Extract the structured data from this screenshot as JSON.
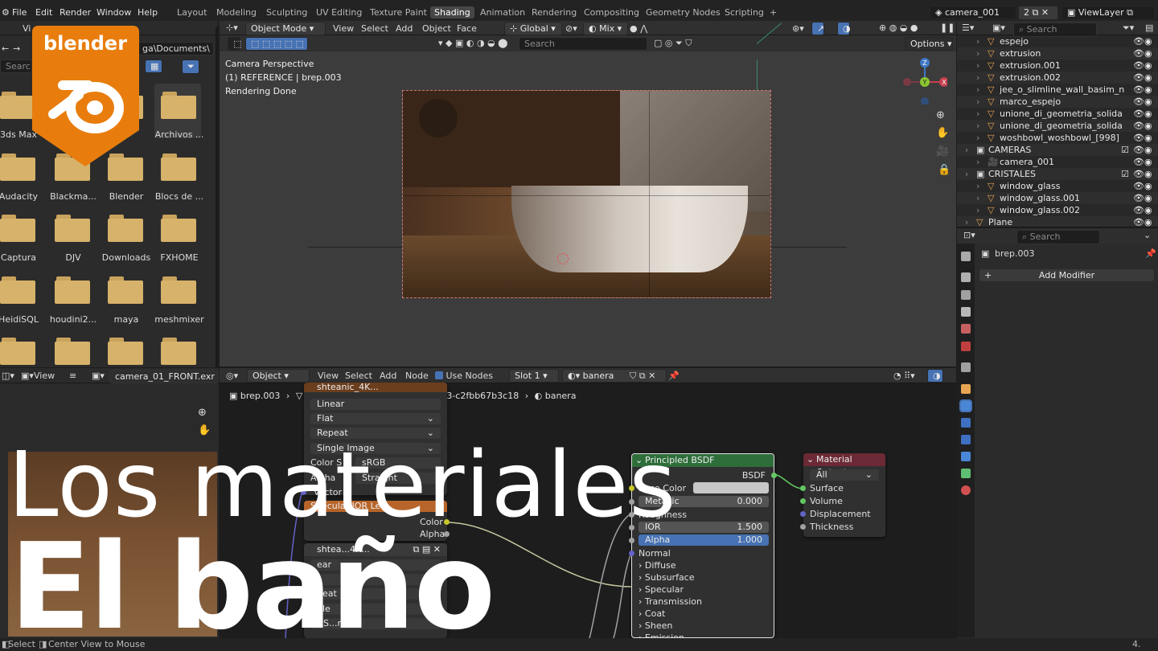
{
  "app": {
    "logo_text": "blender",
    "brand_color": "#e87d0d"
  },
  "topbar": {
    "menus": [
      "File",
      "Edit",
      "Render",
      "Window",
      "Help"
    ],
    "workspaces": [
      "Layout",
      "Modeling",
      "Sculpting",
      "UV Editing",
      "Texture Paint",
      "Shading",
      "Animation",
      "Rendering",
      "Compositing",
      "Geometry Nodes",
      "Scripting"
    ],
    "active_workspace": "Shading",
    "add_tab": "+",
    "scene_name": "camera_001",
    "scene_users": "2",
    "view_layer": "ViewLayer"
  },
  "filebrowser": {
    "header_label": "Vi",
    "path": "ga\\Documents\\",
    "search_placeholder": "Searc",
    "folders": [
      "3ds Max",
      "",
      "",
      "Archivos ...",
      "Audacity",
      "Blackma...",
      "Blender",
      "Blocs de ...",
      "Captura",
      "DJV",
      "Downloads",
      "FXHOME",
      "HeidiSQL",
      "houdini2...",
      "maya",
      "meshmixer",
      "",
      "",
      "",
      ""
    ]
  },
  "viewport": {
    "mode": "Object Mode",
    "menus": [
      "View",
      "Select",
      "Add",
      "Object",
      "Face"
    ],
    "orientation": "Global",
    "snap": "Mix",
    "search_placeholder": "Search",
    "options": "Options",
    "info_line1": "Camera Perspective",
    "info_line2": "(1) REFERENCE | brep.003",
    "info_line3": "Rendering Done",
    "gizmo": {
      "x": "X",
      "y": "Y",
      "z": "Z"
    }
  },
  "outliner": {
    "search_placeholder": "Search",
    "rows": [
      {
        "name": "espejo",
        "indent": 2,
        "type": "mesh"
      },
      {
        "name": "extrusion",
        "indent": 2,
        "type": "mesh"
      },
      {
        "name": "extrusion.001",
        "indent": 2,
        "type": "mesh"
      },
      {
        "name": "extrusion.002",
        "indent": 2,
        "type": "mesh"
      },
      {
        "name": "jee_o_slimline_wall_basim_n",
        "indent": 2,
        "type": "mesh"
      },
      {
        "name": "marco_espejo",
        "indent": 2,
        "type": "mesh"
      },
      {
        "name": "unione_di_geometria_solida",
        "indent": 2,
        "type": "mesh"
      },
      {
        "name": "unione_di_geometria_solida",
        "indent": 2,
        "type": "mesh"
      },
      {
        "name": "woshbowl_woshbowl_[998]",
        "indent": 2,
        "type": "mesh"
      },
      {
        "name": "CAMERAS",
        "indent": 1,
        "type": "collection"
      },
      {
        "name": "camera_001",
        "indent": 2,
        "type": "camera"
      },
      {
        "name": "CRISTALES",
        "indent": 1,
        "type": "collection"
      },
      {
        "name": "window_glass",
        "indent": 2,
        "type": "mesh"
      },
      {
        "name": "window_glass.001",
        "indent": 2,
        "type": "mesh"
      },
      {
        "name": "window_glass.002",
        "indent": 2,
        "type": "mesh"
      },
      {
        "name": "Plane",
        "indent": 1,
        "type": "mesh"
      }
    ]
  },
  "properties": {
    "search_placeholder": "Search",
    "object_name": "brep.003",
    "add_modifier": "Add Modifier"
  },
  "imageeditor": {
    "view_menu": "View",
    "image_name": "camera_01_FRONT.exr"
  },
  "nodeeditor": {
    "type": "Object",
    "menus": [
      "View",
      "Select",
      "Add",
      "Node"
    ],
    "use_nodes": "Use Nodes",
    "slot": "Slot 1",
    "material": "banera",
    "breadcrumb": [
      "brep.003",
      "mesh_acc81581-9c87-4c2c-b353-c2fbb67b3c18",
      "banera"
    ],
    "image_node_1": {
      "title": "shteanic_4K...",
      "interpolation": "Linear",
      "projection": "Flat",
      "extension": "Repeat",
      "source": "Single Image",
      "colorspace_label": "Color S",
      "colorspace": "sRGB",
      "alpha_label": "Alpha",
      "alpha": "Straight",
      "vector": "Vector",
      "out_color": "Color",
      "out_alpha": "Alpha",
      "next_title": "Specular IOR Le..."
    },
    "image_node_2": {
      "title": "shtea...4K...",
      "rows": [
        "ear",
        "t",
        "peat",
        "gle",
        "r S...n-Co"
      ]
    },
    "principled": {
      "title": "Principled BSDF",
      "out": "BSDF",
      "base_color": "Base Color",
      "metallic": "Metallic",
      "metallic_value": "0.000",
      "roughness": "Roughness",
      "ior": "IOR",
      "ior_value": "1.500",
      "alpha": "Alpha",
      "alpha_value": "1.000",
      "normal": "Normal",
      "panels": [
        "Diffuse",
        "Subsurface",
        "Specular",
        "Transmission",
        "Coat",
        "Sheen",
        "Emission"
      ]
    },
    "output": {
      "title": "Material Output",
      "target": "All",
      "inputs": [
        "Surface",
        "Volume",
        "Displacement",
        "Thickness"
      ]
    }
  },
  "statusbar": {
    "select": "Select",
    "center": "Center View to Mouse",
    "version": "4."
  },
  "overlay": {
    "line1": "Los materiales",
    "line2": "El baño"
  },
  "colors": {
    "shader_header": "#2e6e3a",
    "output_header": "#6b2a35",
    "texture_header": "#6b3e1e",
    "socket_shader": "#63c763",
    "socket_color": "#c7c729",
    "socket_float": "#a1a1a1",
    "socket_vector": "#6363c7",
    "alpha_field": "#4772b3",
    "mesh_icon": "#e8a653",
    "mesh_data": "#5fbe73"
  }
}
